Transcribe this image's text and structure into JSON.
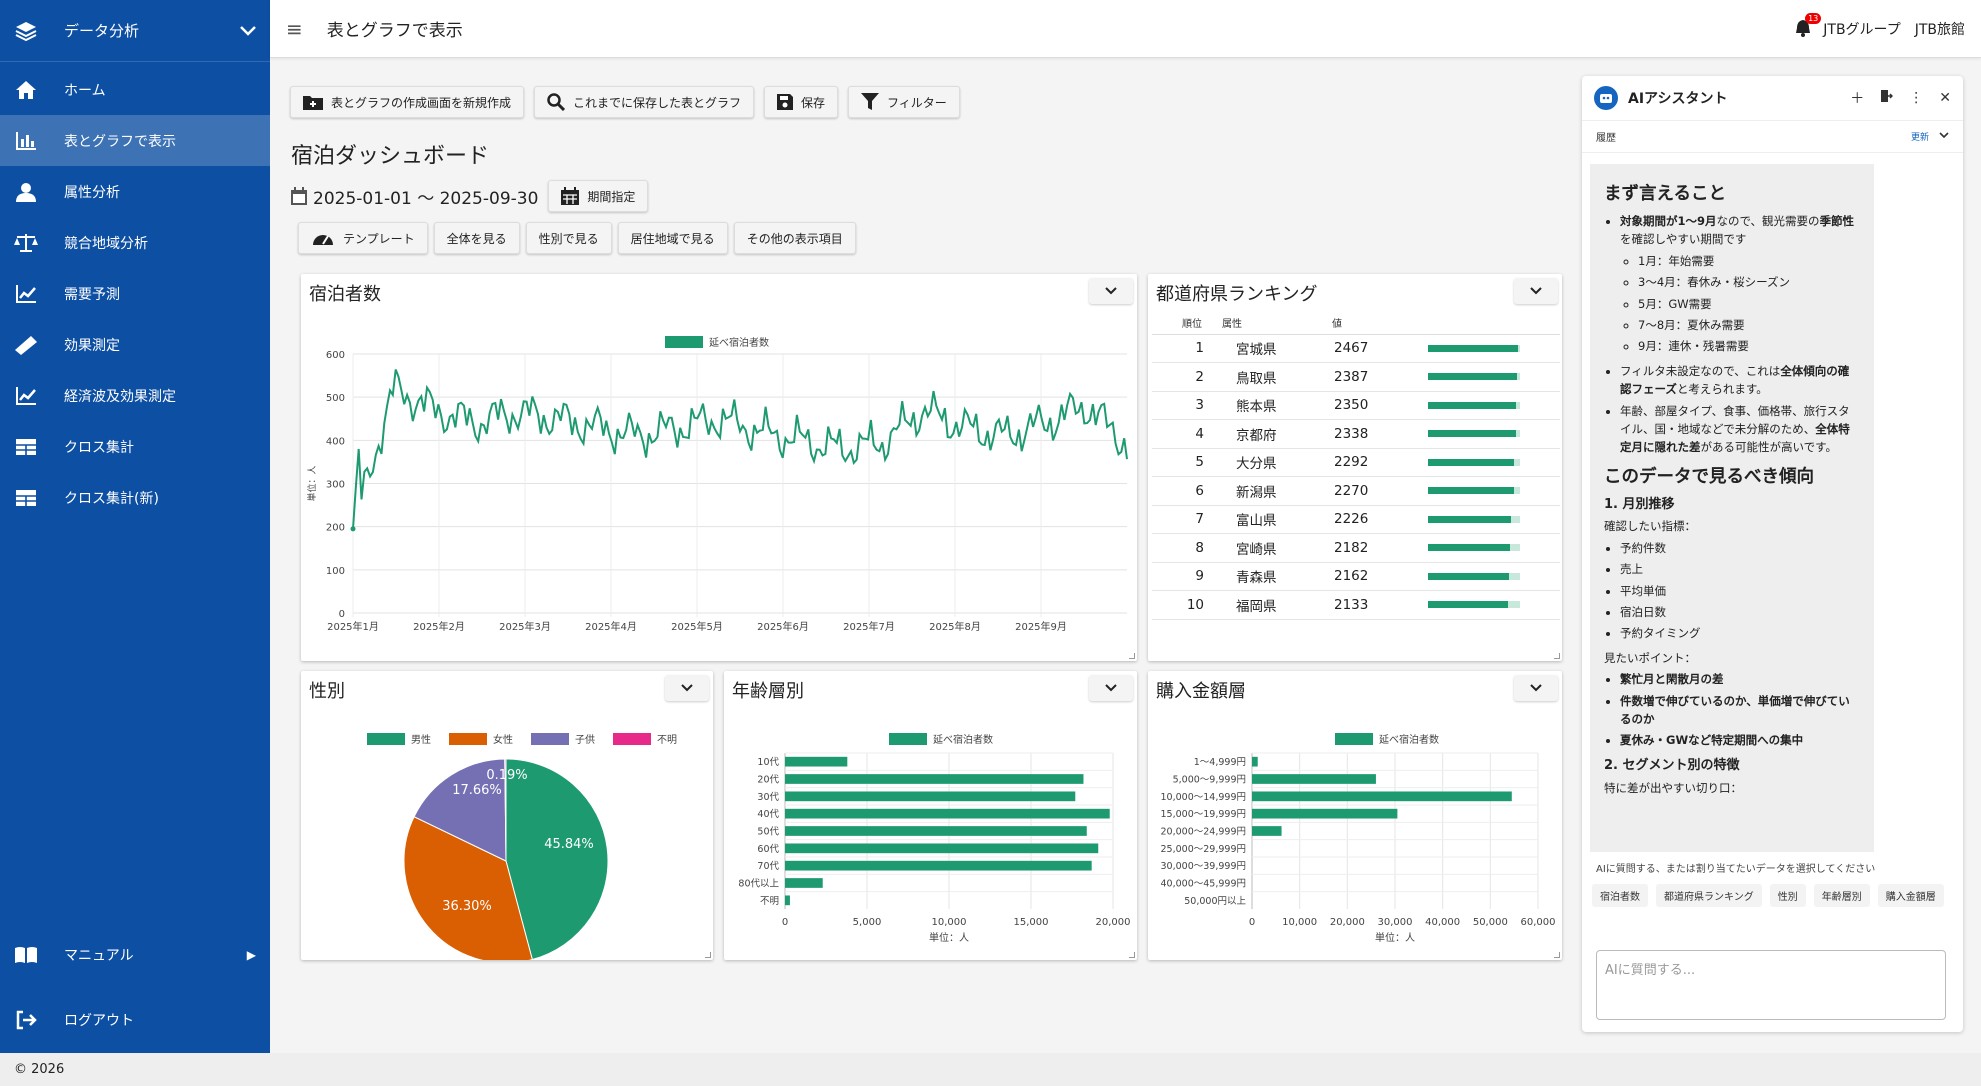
{
  "sidebar": {
    "header": "データ分析",
    "items": [
      {
        "label": "ホーム",
        "icon": "home-icon"
      },
      {
        "label": "表とグラフで表示",
        "icon": "bar-chart-icon",
        "active": true
      },
      {
        "label": "属性分析",
        "icon": "user-icon"
      },
      {
        "label": "競合地域分析",
        "icon": "scale-icon"
      },
      {
        "label": "需要予測",
        "icon": "trend-icon"
      },
      {
        "label": "効果測定",
        "icon": "ruler-icon"
      },
      {
        "label": "経済波及効果測定",
        "icon": "trend-icon"
      },
      {
        "label": "クロス集計",
        "icon": "table-icon"
      },
      {
        "label": "クロス集計(新)",
        "icon": "table-icon"
      }
    ],
    "manual": "マニュアル",
    "logout": "ログアウト"
  },
  "topbar": {
    "title": "表とグラフで表示",
    "badge": "13",
    "org": "JTBグループ　JTB旅館"
  },
  "toolbar": {
    "new_label": "表とグラフの作成画面を新規作成",
    "saved_label": "これまでに保存した表とグラフ",
    "save_label": "保存",
    "filter_label": "フィルター"
  },
  "page": {
    "title": "宿泊ダッシュボード",
    "date_range": "2025-01-01 〜 2025-09-30",
    "period_button": "期間指定",
    "views": [
      "テンプレート",
      "全体を見る",
      "性別で見る",
      "居住地域で見る",
      "その他の表示項目"
    ]
  },
  "cards": {
    "guests": "宿泊者数",
    "ranking": "都道府県ランキング",
    "gender": "性別",
    "age": "年齢層別",
    "purchase": "購入金額層"
  },
  "ranking": {
    "headers": [
      "順位",
      "属性",
      "値"
    ],
    "rows": [
      {
        "rank": "1",
        "pref": "宮城県",
        "value": "2467",
        "ratio": 0.98
      },
      {
        "rank": "2",
        "pref": "鳥取県",
        "value": "2387",
        "ratio": 0.97
      },
      {
        "rank": "3",
        "pref": "熊本県",
        "value": "2350",
        "ratio": 0.96
      },
      {
        "rank": "4",
        "pref": "京都府",
        "value": "2338",
        "ratio": 0.96
      },
      {
        "rank": "5",
        "pref": "大分県",
        "value": "2292",
        "ratio": 0.94
      },
      {
        "rank": "6",
        "pref": "新潟県",
        "value": "2270",
        "ratio": 0.93
      },
      {
        "rank": "7",
        "pref": "富山県",
        "value": "2226",
        "ratio": 0.9
      },
      {
        "rank": "8",
        "pref": "宮崎県",
        "value": "2182",
        "ratio": 0.89
      },
      {
        "rank": "9",
        "pref": "青森県",
        "value": "2162",
        "ratio": 0.88
      },
      {
        "rank": "10",
        "pref": "福岡県",
        "value": "2133",
        "ratio": 0.87
      }
    ]
  },
  "chart_data": [
    {
      "type": "line",
      "legend": "延べ宿泊者数",
      "ylabel": "単位：人",
      "ylim": [
        0,
        600
      ],
      "yticks": [
        0,
        100,
        200,
        300,
        400,
        500,
        600
      ],
      "xticks": [
        "2025年1月",
        "2025年2月",
        "2025年3月",
        "2025年4月",
        "2025年5月",
        "2025年6月",
        "2025年7月",
        "2025年8月",
        "2025年9月"
      ],
      "x_range": [
        "2025-01-01",
        "2025-09-30"
      ],
      "monthly_anchor_values": [
        195,
        520,
        470,
        440,
        465,
        450,
        430,
        410,
        430,
        450,
        420,
        400,
        380,
        395,
        470,
        430,
        410,
        440,
        480,
        390
      ],
      "color": "#1e9a70"
    },
    {
      "type": "pie",
      "legend": [
        "男性",
        "女性",
        "子供",
        "不明"
      ],
      "values": [
        45.84,
        36.3,
        17.66,
        0.19
      ],
      "labels": [
        "45.84%",
        "36.30%",
        "17.66%",
        "0.19%"
      ],
      "colors": [
        "#1e9a70",
        "#d95f02",
        "#7570b3",
        "#e7298a"
      ]
    },
    {
      "type": "bar",
      "orientation": "horizontal",
      "legend": "延べ宿泊者数",
      "categories": [
        "10代",
        "20代",
        "30代",
        "40代",
        "50代",
        "60代",
        "70代",
        "80代以上",
        "不明"
      ],
      "values": [
        3800,
        18200,
        17700,
        19800,
        18400,
        19100,
        18700,
        2300,
        300
      ],
      "xlim": [
        0,
        20000
      ],
      "xticks": [
        "0",
        "5,000",
        "10,000",
        "15,000",
        "20,000"
      ],
      "xlabel": "単位：人",
      "color": "#1e9a70"
    },
    {
      "type": "bar",
      "orientation": "horizontal",
      "legend": "延べ宿泊者数",
      "categories": [
        "1〜4,999円",
        "5,000〜9,999円",
        "10,000〜14,999円",
        "15,000〜19,999円",
        "20,000〜24,999円",
        "25,000〜29,999円",
        "30,000〜39,999円",
        "40,000〜45,999円",
        "50,000円以上"
      ],
      "values": [
        1200,
        26000,
        54500,
        30500,
        6200,
        0,
        0,
        0,
        0
      ],
      "xlim": [
        0,
        60000
      ],
      "xticks": [
        "0",
        "10,000",
        "20,000",
        "30,000",
        "40,000",
        "50,000",
        "60,000"
      ],
      "xlabel": "単位：人",
      "color": "#1e9a70"
    }
  ],
  "ai": {
    "title": "AIアシスタント",
    "history": "履歴",
    "update": "更新",
    "h1": "まず言えること",
    "b1_pre": "対象期間が1〜9月",
    "b1_mid": "なので、観光需要の",
    "b1_bold2": "季節性",
    "b1_post": "を確認しやすい期間です",
    "sub": [
      "1月：年始需要",
      "3〜4月：春休み・桜シーズン",
      "5月：GW需要",
      "7〜8月：夏休み需要",
      "9月：連休・残暑需要"
    ],
    "b2_pre": "フィルタ未設定なので、これは",
    "b2_bold": "全体傾向の確認フェーズ",
    "b2_post": "と考えられます。",
    "b3_pre": "年齢、部屋タイプ、食事、価格帯、旅行スタイル、国・地域などで未分解のため、",
    "b3_bold": "全体特定月に隠れた差",
    "b3_post": "がある可能性が高いです。",
    "h2": "このデータで見るべき傾向",
    "h3_1": "1. 月別推移",
    "p1": "確認したい指標：",
    "metrics": [
      "予約件数",
      "売上",
      "平均単価",
      "宿泊日数",
      "予約タイミング"
    ],
    "p2": "見たいポイント：",
    "points": [
      "繁忙月と閑散月の差",
      "件数増で伸びているのか、単価増で伸びているのか",
      "夏休み・GWなど特定期間への集中"
    ],
    "h3_2": "2. セグメント別の特徴",
    "p3": "特に差が出やすい切り口：",
    "prompt": "AIに質問する、または割り当てたいデータを選択してください",
    "chips": [
      "宿泊者数",
      "都道府県ランキング",
      "性別",
      "年齢層別",
      "購入金額層"
    ],
    "input_placeholder": "AIに質問する..."
  },
  "footer": "© 2026"
}
